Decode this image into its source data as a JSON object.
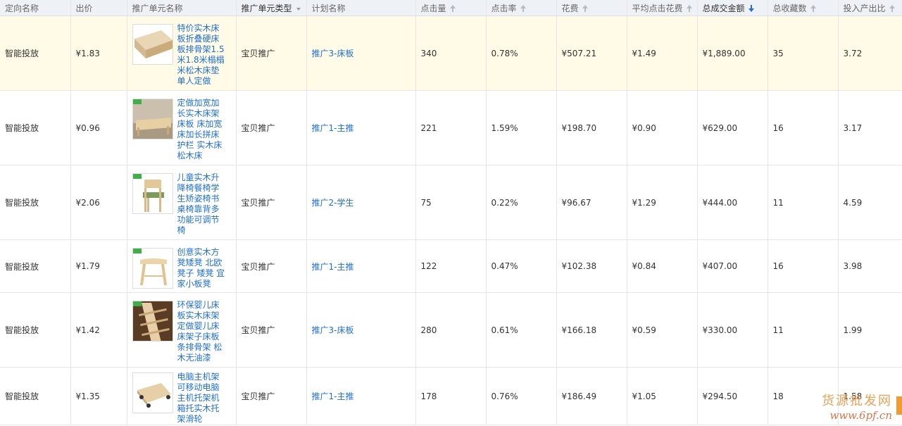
{
  "columns": [
    {
      "label": "定向名称",
      "sort": "none"
    },
    {
      "label": "出价",
      "sort": "none"
    },
    {
      "label": "推广单元名称",
      "sort": "none"
    },
    {
      "label": "推广单元类型",
      "sort": "dropdown"
    },
    {
      "label": "计划名称",
      "sort": "none"
    },
    {
      "label": "点击量",
      "sort": "up"
    },
    {
      "label": "点击率",
      "sort": "up"
    },
    {
      "label": "花费",
      "sort": "up"
    },
    {
      "label": "平均点击花费",
      "sort": "up"
    },
    {
      "label": "总成交金额",
      "sort": "down-active"
    },
    {
      "label": "总收藏数",
      "sort": "up"
    },
    {
      "label": "投入产出比",
      "sort": "up"
    }
  ],
  "rows": [
    {
      "target": "智能投放",
      "bid": "¥1.83",
      "unit_title": "特价实木床板折叠硬床板排骨架1.5米1.8米榻榻米松木床垫单人定做",
      "unit_type": "宝贝推广",
      "plan": "推广3-床板",
      "clicks": "340",
      "ctr": "0.78%",
      "cost": "¥507.21",
      "cpc": "¥1.49",
      "gmv": "¥1,889.00",
      "favs": "35",
      "roi": "3.72",
      "thumb": "bed-board"
    },
    {
      "target": "智能投放",
      "bid": "¥0.96",
      "unit_title": "定做加宽加长实木床架床板 床加宽床加长拼床护栏 实木床松木床",
      "unit_type": "宝贝推广",
      "plan": "推广1-主推",
      "clicks": "221",
      "ctr": "1.59%",
      "cost": "¥198.70",
      "cpc": "¥0.90",
      "gmv": "¥629.00",
      "favs": "16",
      "roi": "3.17",
      "thumb": "bed-frame"
    },
    {
      "target": "智能投放",
      "bid": "¥2.06",
      "unit_title": "儿童实木升降椅餐椅学生矫姿椅书桌椅靠背多功能可调节椅",
      "unit_type": "宝贝推广",
      "plan": "推广2-学生",
      "clicks": "75",
      "ctr": "0.22%",
      "cost": "¥96.67",
      "cpc": "¥1.29",
      "gmv": "¥444.00",
      "favs": "11",
      "roi": "4.59",
      "thumb": "chair"
    },
    {
      "target": "智能投放",
      "bid": "¥1.79",
      "unit_title": "创意实木方凳矮凳 北欧凳子 矮凳 宜家小板凳",
      "unit_type": "宝贝推广",
      "plan": "推广1-主推",
      "clicks": "122",
      "ctr": "0.47%",
      "cost": "¥102.38",
      "cpc": "¥0.84",
      "gmv": "¥407.00",
      "favs": "16",
      "roi": "3.98",
      "thumb": "stool"
    },
    {
      "target": "智能投放",
      "bid": "¥1.42",
      "unit_title": "环保婴儿床板实木床架定做婴儿床床架子床板条排骨架 松木无油漆",
      "unit_type": "宝贝推广",
      "plan": "推广3-床板",
      "clicks": "280",
      "ctr": "0.61%",
      "cost": "¥166.18",
      "cpc": "¥0.59",
      "gmv": "¥330.00",
      "favs": "11",
      "roi": "1.99",
      "thumb": "slats"
    },
    {
      "target": "智能投放",
      "bid": "¥1.35",
      "unit_title": "电脑主机架可移动电脑主机托架机箱托实木托架滑轮",
      "unit_type": "宝贝推广",
      "plan": "推广1-主推",
      "clicks": "178",
      "ctr": "0.76%",
      "cost": "¥186.49",
      "cpc": "¥1.05",
      "gmv": "¥294.50",
      "favs": "18",
      "roi": "1.58",
      "thumb": "pc-stand"
    }
  ],
  "watermark": {
    "line1": "货源批发网",
    "line2": "www.6pf.cn"
  },
  "colors": {
    "link": "#1f6fd6",
    "header_bg": "#eef1f6",
    "highlight_row": "#fffbe6",
    "sort_active": "#1f6fd6"
  }
}
